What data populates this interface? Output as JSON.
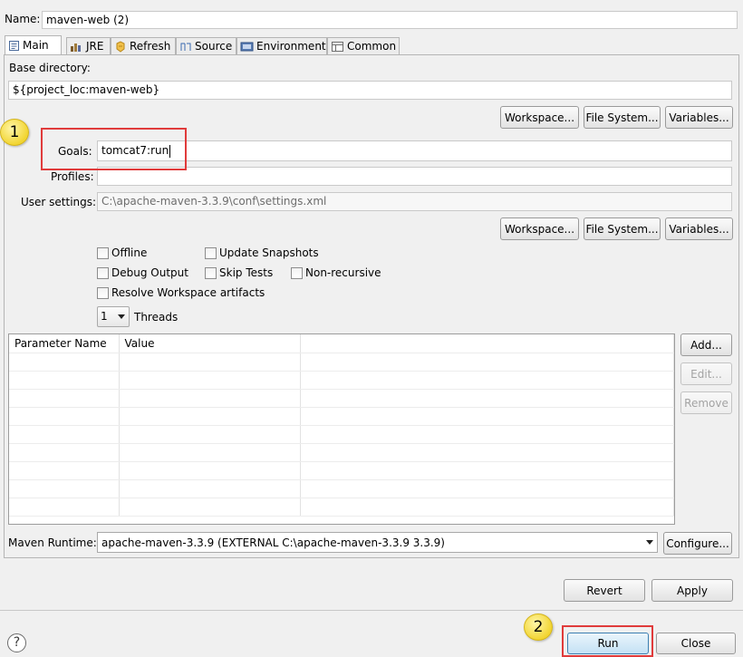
{
  "name": {
    "label": "Name:",
    "value": "maven-web (2)"
  },
  "tabs": [
    {
      "label": "Main",
      "icon": "main-tab-icon",
      "active": true
    },
    {
      "label": "JRE",
      "icon": "jre-icon"
    },
    {
      "label": "Refresh",
      "icon": "refresh-icon"
    },
    {
      "label": "Source",
      "icon": "source-icon"
    },
    {
      "label": "Environment",
      "icon": "environment-icon"
    },
    {
      "label": "Common",
      "icon": "common-icon"
    }
  ],
  "base_directory": {
    "label": "Base directory:",
    "value": "${project_loc:maven-web}"
  },
  "dir_buttons": {
    "workspace": "Workspace...",
    "file_system": "File System...",
    "variables": "Variables..."
  },
  "goals": {
    "label": "Goals:",
    "value": "tomcat7:run"
  },
  "profiles": {
    "label": "Profiles:",
    "value": ""
  },
  "user_settings": {
    "label": "User settings:",
    "value": "C:\\apache-maven-3.3.9\\conf\\settings.xml"
  },
  "settings_buttons": {
    "workspace": "Workspace...",
    "file_system": "File System...",
    "variables": "Variables..."
  },
  "options": {
    "offline": "Offline",
    "update_snapshots": "Update Snapshots",
    "debug_output": "Debug Output",
    "skip_tests": "Skip Tests",
    "non_recursive": "Non-recursive",
    "resolve_workspace": "Resolve Workspace artifacts"
  },
  "threads": {
    "value": "1",
    "label": "Threads"
  },
  "parameters": {
    "columns": [
      "Parameter Name",
      "Value"
    ],
    "rows": [],
    "buttons": {
      "add": "Add...",
      "edit": "Edit...",
      "remove": "Remove"
    }
  },
  "maven_runtime": {
    "label": "Maven Runtime:",
    "value": "apache-maven-3.3.9 (EXTERNAL C:\\apache-maven-3.3.9 3.3.9)",
    "configure": "Configure..."
  },
  "footer": {
    "revert": "Revert",
    "apply": "Apply",
    "run": "Run",
    "close": "Close",
    "help_icon": "help-icon"
  },
  "callouts": {
    "one": "1",
    "two": "2"
  },
  "colors": {
    "highlight": "#e03b3b",
    "callout": "#f2d532",
    "window_bg": "#f0f0f0"
  }
}
